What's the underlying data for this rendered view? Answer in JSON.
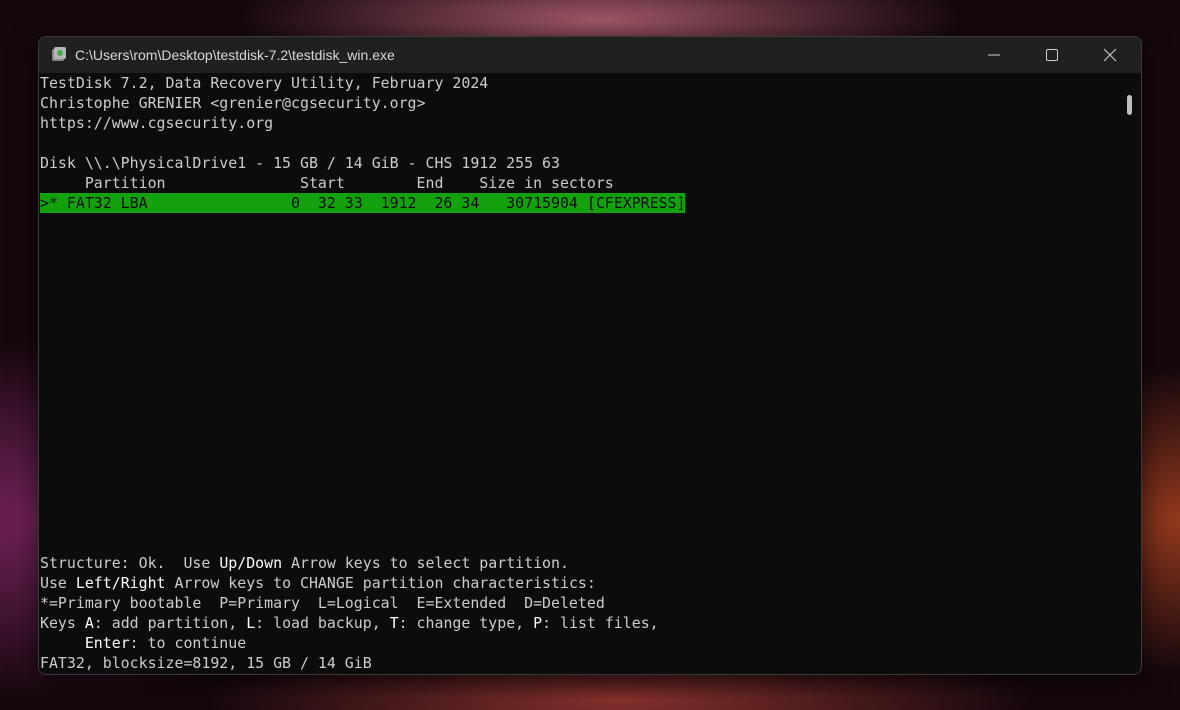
{
  "window": {
    "title": "C:\\Users\\rom\\Desktop\\testdisk-7.2\\testdisk_win.exe",
    "icon": "testdisk-app-icon",
    "controls": [
      "minimize-icon",
      "maximize-icon",
      "close-icon"
    ]
  },
  "terminal": {
    "header": [
      "TestDisk 7.2, Data Recovery Utility, February 2024",
      "Christophe GRENIER <grenier@cgsecurity.org>",
      "https://www.cgsecurity.org"
    ],
    "disk_info": "Disk \\\\.\\PhysicalDrive1 - 15 GB / 14 GiB - CHS 1912 255 63",
    "columns_header": "     Partition               Start        End    Size in sectors",
    "partition_row": ">* FAT32 LBA                0  32 33  1912  26 34   30715904 [CFEXPRESS]",
    "footer": {
      "l1_a": "Structure: Ok.  Use ",
      "l1_b": "Up/Down",
      "l1_c": " Arrow keys to select partition.",
      "l2_a": "Use ",
      "l2_b": "Left/Right",
      "l2_c": " Arrow keys to CHANGE partition characteristics:",
      "l3": "*=Primary bootable  P=Primary  L=Logical  E=Extended  D=Deleted",
      "l4_a": "Keys ",
      "l4_b": "A",
      "l4_c": ": add partition, ",
      "l4_d": "L",
      "l4_e": ": load backup, ",
      "l4_f": "T",
      "l4_g": ": change type, ",
      "l4_h": "P",
      "l4_i": ": list files,",
      "l5_a": "     ",
      "l5_b": "Enter",
      "l5_c": ": to continue",
      "l6": "FAT32, blocksize=8192, 15 GB / 14 GiB"
    }
  },
  "colors": {
    "selection": "#13a10e",
    "text": "#cccccc",
    "highlight": "#ffffff",
    "background": "#0c0c0c"
  }
}
